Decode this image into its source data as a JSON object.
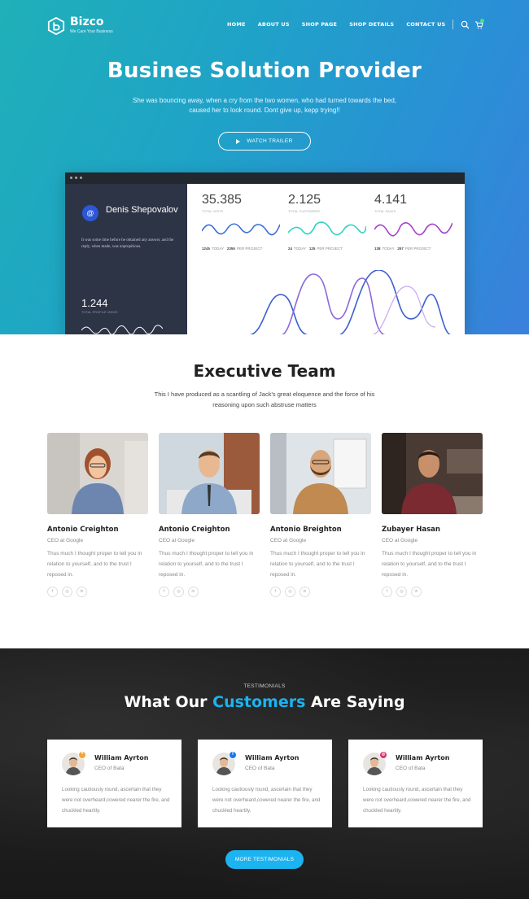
{
  "brand": {
    "name": "Bizco",
    "tagline": "We Care Your Business"
  },
  "nav": {
    "items": [
      "HOME",
      "ABOUT US",
      "SHOP PAGE",
      "SHOP DETAILS",
      "CONTACT US"
    ],
    "icons": [
      "search-icon",
      "cart-icon"
    ]
  },
  "hero": {
    "title": "Busines Solution Provider",
    "subtitle": "She was bouncing away, when a cry from the two women, who had turned towards the bed, caused her to look round. Dont give up, kepp trying!!",
    "button": "WATCH TRAILER"
  },
  "dashboard": {
    "profile": {
      "initial": "@",
      "name": "Denis Shepovalov",
      "text": "It was some time before he obtained any answer, and the reply, when made, was unpropitious.",
      "number": "1.244",
      "label": "TOTAL PROFILE VIEWS"
    },
    "stats": [
      {
        "value": "35.385",
        "label": "TOTAL VISITS",
        "today": "1245",
        "today_label": "TODAY",
        "project": "2355",
        "project_label": "PER PROJECT",
        "color": "#3b6fd8"
      },
      {
        "value": "2.125",
        "label": "TOTAL CUSTOMERS",
        "today": "24",
        "today_label": "TODAY",
        "project": "125",
        "project_label": "PER PROJECT",
        "color": "#2fd1c4"
      },
      {
        "value": "4.141",
        "label": "TOTAL SALES",
        "today": "138",
        "today_label": "TODAY",
        "project": "257",
        "project_label": "PER PROJECT",
        "color": "#a43fc9"
      }
    ]
  },
  "team": {
    "title": "Executive Team",
    "subtitle": "This I have produced as a scantling of Jack's great eloquence and the force of his reasoning upon such abstruse matters",
    "members": [
      {
        "name": "Antonio Creighton",
        "role": "CEO at Google",
        "bio": "Thus much I thought proper to tell you in relation to yourself, and to the trust I reposed in."
      },
      {
        "name": "Antonio Creighton",
        "role": "CEO at Google",
        "bio": "Thus much I thought proper to tell you in relation to yourself, and to the trust I reposed in."
      },
      {
        "name": "Antonio Breighton",
        "role": "CEO at Google",
        "bio": "Thus much I thought proper to tell you in relation to yourself, and to the trust I reposed in."
      },
      {
        "name": "Zubayer Hasan",
        "role": "CEO at Google",
        "bio": "Thus much I thought proper to tell you in relation to yourself, and to the trust I reposed in."
      }
    ],
    "social_icons": [
      "facebook-icon",
      "instagram-icon",
      "linkedin-icon"
    ]
  },
  "testimonials": {
    "eyebrow": "TESTIMONIALS",
    "title_a": "What Our ",
    "title_hl": "Customers",
    "title_b": " Are Saying",
    "items": [
      {
        "name": "William Ayrton",
        "role": "CEO of Bata",
        "text": "Looking cautiously round, ascertain that they were not overheard,cowered nearer the fire, and chuckled heartily.",
        "badge_color": "#f2a33a"
      },
      {
        "name": "William Ayrton",
        "role": "CEO of Bata",
        "text": "Looking cautiously round, ascertain that they were not overheard,cowered nearer the fire, and chuckled heartily.",
        "badge_color": "#1877f2"
      },
      {
        "name": "William Ayrton",
        "role": "CEO of Bata",
        "text": "Looking cautiously round, ascertain that they were not overheard,cowered nearer the fire, and chuckled heartily.",
        "badge_color": "#e1306c"
      }
    ],
    "button": "MORE TESTIMONIALS"
  },
  "colors": {
    "accent": "#1bb3f0",
    "hero_start": "#1fb0b8",
    "hero_end": "#3a80dc",
    "dark_bg": "#1c1c1c"
  }
}
